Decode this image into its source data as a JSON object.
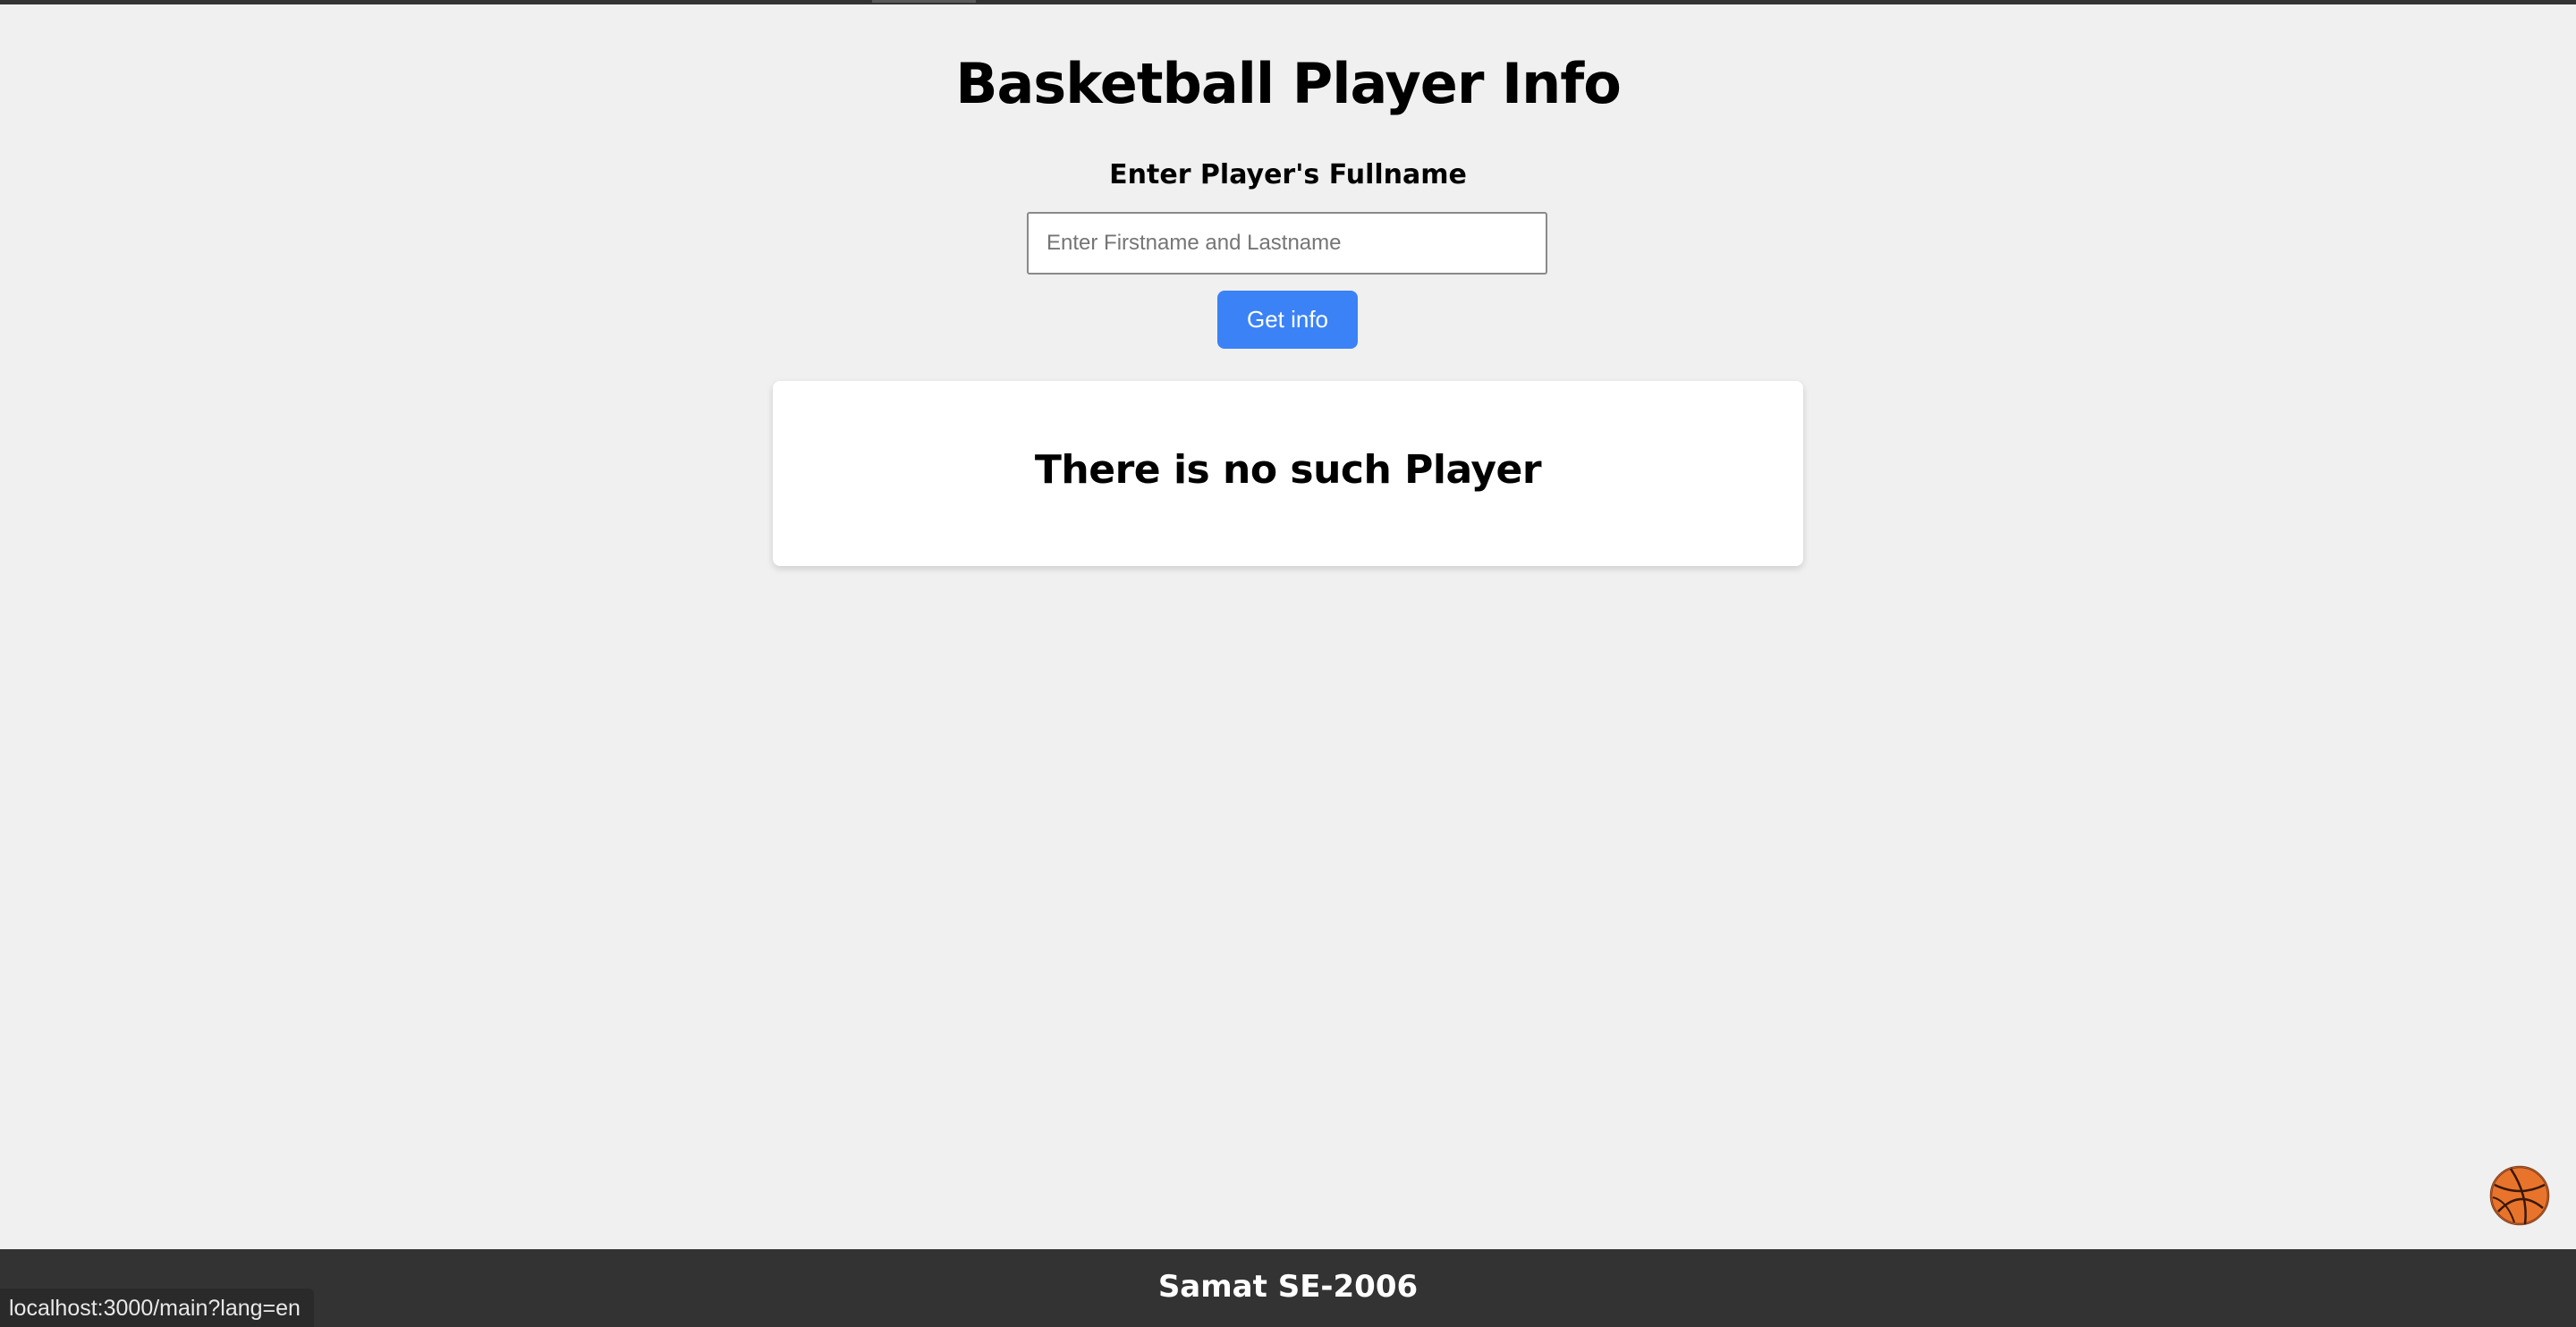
{
  "header": {
    "title": "Basketball Player Info",
    "subtitle": "Enter Player's Fullname"
  },
  "search": {
    "value": "",
    "placeholder": "Enter Firstname and Lastname",
    "button_label": "Get info"
  },
  "result": {
    "message": "There is no such Player"
  },
  "footer": {
    "text": "Samat SE-2006"
  },
  "status_bar": {
    "url": "localhost:3000/main?lang=en"
  },
  "icons": {
    "floating": "basketball-icon"
  },
  "colors": {
    "background": "#f0f0f0",
    "button": "#3b82f6",
    "footer": "#333333",
    "card": "#ffffff",
    "ball": "#e8742c"
  }
}
